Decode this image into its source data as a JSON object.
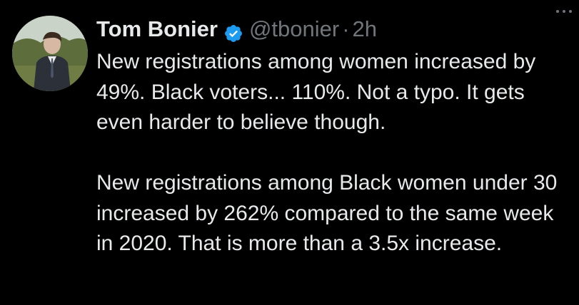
{
  "tweet": {
    "author": {
      "display_name": "Tom Bonier",
      "handle": "@tbonier",
      "separator": "·",
      "timestamp": "2h",
      "verified_icon": "verified-badge-icon",
      "avatar": "profile-avatar"
    },
    "more_icon": "more-options-icon",
    "paragraphs": [
      "New registrations among women increased by 49%. Black voters... 110%. Not a typo. It gets even harder to believe though.",
      "New registrations among Black women under 30 increased by 262% compared to the same week in 2020. That is more than a 3.5x increase."
    ]
  },
  "colors": {
    "background": "#000000",
    "primary_text": "#e7e9ea",
    "secondary_text": "#71767b",
    "verified_blue": "#1d9bf0"
  }
}
